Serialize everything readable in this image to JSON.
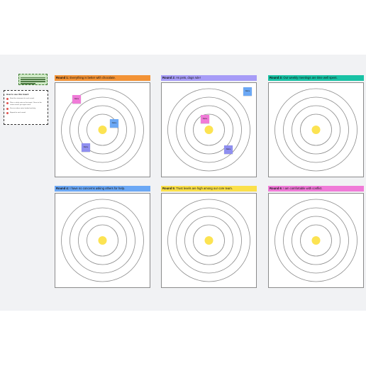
{
  "intro_note": {
    "lines": 4,
    "color": "#cfe9c6"
  },
  "howto": {
    "title": "How to use this board",
    "steps": [
      "Read the statement for each round.",
      "Place a sticky note on the target. Closer to the center means you agree more.",
      "Discuss where notes landed and why.",
      "Repeat for each round."
    ]
  },
  "rounds": [
    {
      "label": "Round 1:",
      "statement": "Everything is better with chocolate.",
      "color": "#f39336",
      "stickies": [
        {
          "text": "Name",
          "color": "#f07bd8"
        },
        {
          "text": "Name",
          "color": "#6ba8f5"
        },
        {
          "text": "Name",
          "color": "#8f8ff0"
        }
      ]
    },
    {
      "label": "Round 2:",
      "statement": "As pets, dogs rule!",
      "color": "#a79cf7",
      "stickies": [
        {
          "text": "Name",
          "color": "#6ba8f5"
        },
        {
          "text": "Name",
          "color": "#f07bd8"
        },
        {
          "text": "Name",
          "color": "#8f8ff0"
        }
      ]
    },
    {
      "label": "Round 3:",
      "statement": "Our weekly meetings are time well spent.",
      "color": "#19c2a5",
      "stickies": []
    },
    {
      "label": "Round 4:",
      "statement": "I have no concerns asking others for help.",
      "color": "#6ba8f5",
      "stickies": []
    },
    {
      "label": "Round 5:",
      "statement": "Trust levels are high among our core team.",
      "color": "#fbe04a",
      "stickies": []
    },
    {
      "label": "Round 6:",
      "statement": "I am comfortable with conflict.",
      "color": "#f07bd8",
      "stickies": []
    }
  ],
  "colors": {
    "ring": "#8b8b8b",
    "bullseye": "#fce352",
    "board": "#f1f2f4"
  }
}
